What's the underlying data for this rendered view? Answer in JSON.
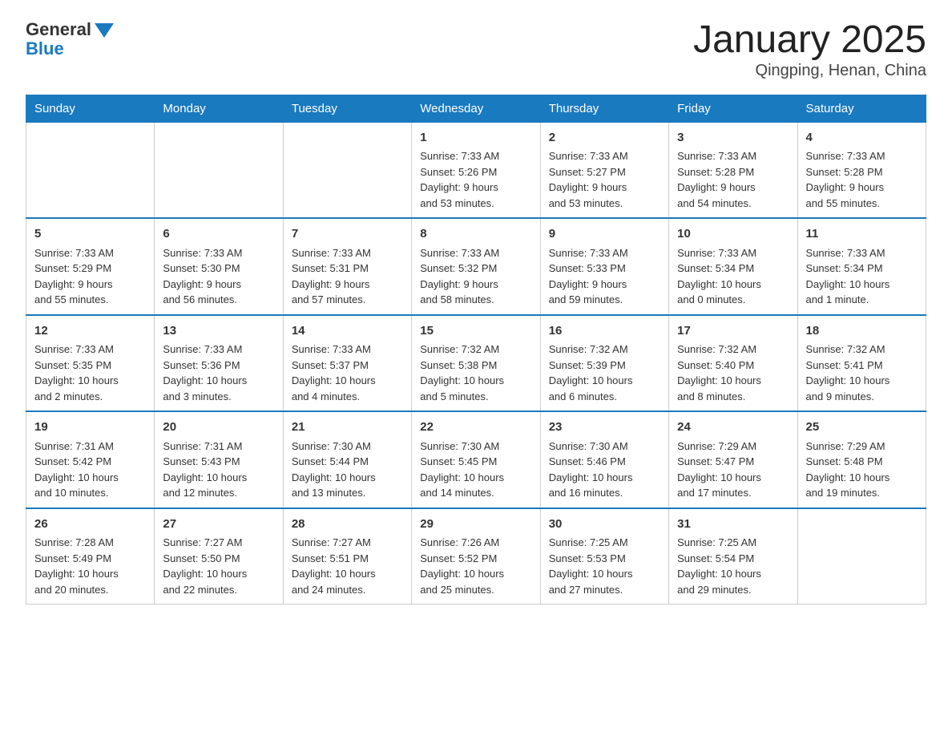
{
  "logo": {
    "general": "General",
    "blue": "Blue"
  },
  "title": "January 2025",
  "subtitle": "Qingping, Henan, China",
  "days": [
    "Sunday",
    "Monday",
    "Tuesday",
    "Wednesday",
    "Thursday",
    "Friday",
    "Saturday"
  ],
  "weeks": [
    [
      {
        "day": "",
        "info": ""
      },
      {
        "day": "",
        "info": ""
      },
      {
        "day": "",
        "info": ""
      },
      {
        "day": "1",
        "info": "Sunrise: 7:33 AM\nSunset: 5:26 PM\nDaylight: 9 hours\nand 53 minutes."
      },
      {
        "day": "2",
        "info": "Sunrise: 7:33 AM\nSunset: 5:27 PM\nDaylight: 9 hours\nand 53 minutes."
      },
      {
        "day": "3",
        "info": "Sunrise: 7:33 AM\nSunset: 5:28 PM\nDaylight: 9 hours\nand 54 minutes."
      },
      {
        "day": "4",
        "info": "Sunrise: 7:33 AM\nSunset: 5:28 PM\nDaylight: 9 hours\nand 55 minutes."
      }
    ],
    [
      {
        "day": "5",
        "info": "Sunrise: 7:33 AM\nSunset: 5:29 PM\nDaylight: 9 hours\nand 55 minutes."
      },
      {
        "day": "6",
        "info": "Sunrise: 7:33 AM\nSunset: 5:30 PM\nDaylight: 9 hours\nand 56 minutes."
      },
      {
        "day": "7",
        "info": "Sunrise: 7:33 AM\nSunset: 5:31 PM\nDaylight: 9 hours\nand 57 minutes."
      },
      {
        "day": "8",
        "info": "Sunrise: 7:33 AM\nSunset: 5:32 PM\nDaylight: 9 hours\nand 58 minutes."
      },
      {
        "day": "9",
        "info": "Sunrise: 7:33 AM\nSunset: 5:33 PM\nDaylight: 9 hours\nand 59 minutes."
      },
      {
        "day": "10",
        "info": "Sunrise: 7:33 AM\nSunset: 5:34 PM\nDaylight: 10 hours\nand 0 minutes."
      },
      {
        "day": "11",
        "info": "Sunrise: 7:33 AM\nSunset: 5:34 PM\nDaylight: 10 hours\nand 1 minute."
      }
    ],
    [
      {
        "day": "12",
        "info": "Sunrise: 7:33 AM\nSunset: 5:35 PM\nDaylight: 10 hours\nand 2 minutes."
      },
      {
        "day": "13",
        "info": "Sunrise: 7:33 AM\nSunset: 5:36 PM\nDaylight: 10 hours\nand 3 minutes."
      },
      {
        "day": "14",
        "info": "Sunrise: 7:33 AM\nSunset: 5:37 PM\nDaylight: 10 hours\nand 4 minutes."
      },
      {
        "day": "15",
        "info": "Sunrise: 7:32 AM\nSunset: 5:38 PM\nDaylight: 10 hours\nand 5 minutes."
      },
      {
        "day": "16",
        "info": "Sunrise: 7:32 AM\nSunset: 5:39 PM\nDaylight: 10 hours\nand 6 minutes."
      },
      {
        "day": "17",
        "info": "Sunrise: 7:32 AM\nSunset: 5:40 PM\nDaylight: 10 hours\nand 8 minutes."
      },
      {
        "day": "18",
        "info": "Sunrise: 7:32 AM\nSunset: 5:41 PM\nDaylight: 10 hours\nand 9 minutes."
      }
    ],
    [
      {
        "day": "19",
        "info": "Sunrise: 7:31 AM\nSunset: 5:42 PM\nDaylight: 10 hours\nand 10 minutes."
      },
      {
        "day": "20",
        "info": "Sunrise: 7:31 AM\nSunset: 5:43 PM\nDaylight: 10 hours\nand 12 minutes."
      },
      {
        "day": "21",
        "info": "Sunrise: 7:30 AM\nSunset: 5:44 PM\nDaylight: 10 hours\nand 13 minutes."
      },
      {
        "day": "22",
        "info": "Sunrise: 7:30 AM\nSunset: 5:45 PM\nDaylight: 10 hours\nand 14 minutes."
      },
      {
        "day": "23",
        "info": "Sunrise: 7:30 AM\nSunset: 5:46 PM\nDaylight: 10 hours\nand 16 minutes."
      },
      {
        "day": "24",
        "info": "Sunrise: 7:29 AM\nSunset: 5:47 PM\nDaylight: 10 hours\nand 17 minutes."
      },
      {
        "day": "25",
        "info": "Sunrise: 7:29 AM\nSunset: 5:48 PM\nDaylight: 10 hours\nand 19 minutes."
      }
    ],
    [
      {
        "day": "26",
        "info": "Sunrise: 7:28 AM\nSunset: 5:49 PM\nDaylight: 10 hours\nand 20 minutes."
      },
      {
        "day": "27",
        "info": "Sunrise: 7:27 AM\nSunset: 5:50 PM\nDaylight: 10 hours\nand 22 minutes."
      },
      {
        "day": "28",
        "info": "Sunrise: 7:27 AM\nSunset: 5:51 PM\nDaylight: 10 hours\nand 24 minutes."
      },
      {
        "day": "29",
        "info": "Sunrise: 7:26 AM\nSunset: 5:52 PM\nDaylight: 10 hours\nand 25 minutes."
      },
      {
        "day": "30",
        "info": "Sunrise: 7:25 AM\nSunset: 5:53 PM\nDaylight: 10 hours\nand 27 minutes."
      },
      {
        "day": "31",
        "info": "Sunrise: 7:25 AM\nSunset: 5:54 PM\nDaylight: 10 hours\nand 29 minutes."
      },
      {
        "day": "",
        "info": ""
      }
    ]
  ]
}
